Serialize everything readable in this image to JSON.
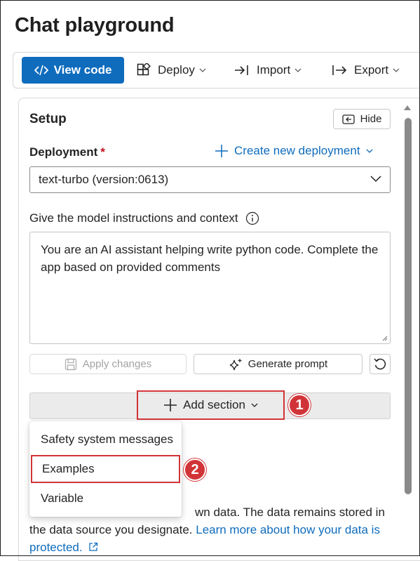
{
  "page": {
    "title": "Chat playground"
  },
  "toolbar": {
    "view_code": "View code",
    "deploy": "Deploy",
    "import": "Import",
    "export": "Export"
  },
  "setup": {
    "title": "Setup",
    "hide": "Hide",
    "deployment_label": "Deployment",
    "required_mark": "*",
    "create_deployment": "Create new deployment",
    "deployment_value": "text-turbo (version:0613)",
    "instructions_label": "Give the model instructions and context",
    "instructions_value": "You are an AI assistant helping write python code. Complete the app based on provided comments",
    "apply_changes": "Apply changes",
    "generate_prompt": "Generate prompt",
    "add_section": "Add section"
  },
  "menu": {
    "items": [
      {
        "label": "Safety system messages"
      },
      {
        "label": "Examples"
      },
      {
        "label": "Variable"
      }
    ]
  },
  "annotations": {
    "one": "1",
    "two": "2",
    "color": "#d13438"
  },
  "body": {
    "line1_visible": "wn data. The data remains stored in",
    "line2_pre": "the data source you designate. ",
    "link": "Learn more about how your data is protected."
  },
  "colors": {
    "accent": "#0f6cbd",
    "highlight": "#d13438"
  }
}
